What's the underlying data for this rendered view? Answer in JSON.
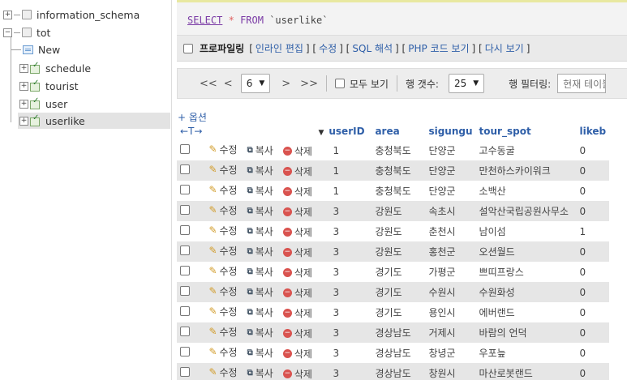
{
  "nav": {
    "items": [
      {
        "label": "information_schema",
        "kind": "database",
        "expanded": false
      },
      {
        "label": "tot",
        "kind": "database",
        "expanded": true
      },
      {
        "label": "New",
        "kind": "new"
      },
      {
        "label": "schedule",
        "kind": "table"
      },
      {
        "label": "tourist",
        "kind": "table"
      },
      {
        "label": "user",
        "kind": "table"
      },
      {
        "label": "userlike",
        "kind": "table",
        "selected": true
      }
    ]
  },
  "query": {
    "select": "SELECT",
    "star": "*",
    "from": "FROM",
    "table": "`userlike`"
  },
  "profile": {
    "label": "프로파일링",
    "links": [
      "인라인 편집",
      "수정",
      "SQL 해석",
      "PHP 코드 보기",
      "다시 보기"
    ]
  },
  "pager": {
    "first": "<<",
    "prev": "<",
    "page": "6",
    "next": ">",
    "last": ">>",
    "show_all": "모두 보기",
    "rows_label": "행 갯수:",
    "rows_value": "25",
    "filter_label": "행 필터링:",
    "filter_placeholder": "현재 테이블 검색"
  },
  "options_link": "+ 옵션",
  "arrows": "←T→",
  "columns": [
    "userID",
    "area",
    "sigungu",
    "tour_spot",
    "likeb"
  ],
  "actions": {
    "edit": "수정",
    "copy": "복사",
    "delete": "삭제"
  },
  "rows": [
    [
      "1",
      "충청북도",
      "단양군",
      "고수동굴",
      "0"
    ],
    [
      "1",
      "충청북도",
      "단양군",
      "만천하스카이워크",
      "0"
    ],
    [
      "1",
      "충청북도",
      "단양군",
      "소백산",
      "0"
    ],
    [
      "3",
      "강원도",
      "속초시",
      "설악산국립공원사무소",
      "0"
    ],
    [
      "3",
      "강원도",
      "춘천시",
      "남이섬",
      "1"
    ],
    [
      "3",
      "강원도",
      "홍천군",
      "오션월드",
      "0"
    ],
    [
      "3",
      "경기도",
      "가평군",
      "쁘띠프랑스",
      "0"
    ],
    [
      "3",
      "경기도",
      "수원시",
      "수원화성",
      "0"
    ],
    [
      "3",
      "경기도",
      "용인시",
      "에버랜드",
      "0"
    ],
    [
      "3",
      "경상남도",
      "거제시",
      "바람의 언덕",
      "0"
    ],
    [
      "3",
      "경상남도",
      "창녕군",
      "우포늪",
      "0"
    ],
    [
      "3",
      "경상남도",
      "창원시",
      "마산로봇랜드",
      "0"
    ]
  ]
}
